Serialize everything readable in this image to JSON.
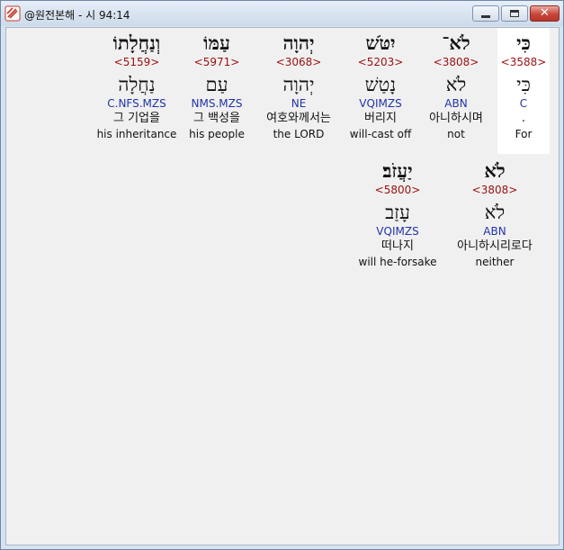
{
  "window": {
    "title": "@원전본해 - 시 94:14"
  },
  "row1": [
    {
      "hebrew": "כִּי",
      "strongs": "<3588>",
      "lemma": "כִּי",
      "morph": "C",
      "korean": ".",
      "english": "For",
      "selected": true
    },
    {
      "hebrew": "לֹא־",
      "strongs": "<3808>",
      "lemma": "לֹא",
      "morph": "ABN",
      "korean": "아니하시며",
      "english": "not"
    },
    {
      "hebrew": "יִטֹּשׁ",
      "strongs": "<5203>",
      "lemma": "נָטַשׁ",
      "morph": "VQIMZS",
      "korean": "버리지",
      "english": "will-cast off"
    },
    {
      "hebrew": "יְהוָה",
      "strongs": "<3068>",
      "lemma": "יְהוָה",
      "morph": "NE",
      "korean": "여호와께서는",
      "english": "the LORD"
    },
    {
      "hebrew": "עַמּוֹ",
      "strongs": "<5971>",
      "lemma": "עַם",
      "morph": "NMS.MZS",
      "korean": "그 백성을",
      "english": "his people"
    },
    {
      "hebrew": "וְנַחֲלָתוֹ",
      "strongs": "<5159>",
      "lemma": "נַחֲלָה",
      "morph": "C.NFS.MZS",
      "korean": "그 기업을",
      "english": "his inheritance"
    }
  ],
  "row2": [
    {
      "hebrew": "לֹא",
      "strongs": "<3808>",
      "lemma": "לֹא",
      "morph": "ABN",
      "korean": "아니하시리로다",
      "english": "neither"
    },
    {
      "hebrew": "יַעֲזֹב׃",
      "strongs": "<5800>",
      "lemma": "עָזַב",
      "morph": "VQIMZS",
      "korean": "떠나지",
      "english": "will he-forsake"
    }
  ]
}
